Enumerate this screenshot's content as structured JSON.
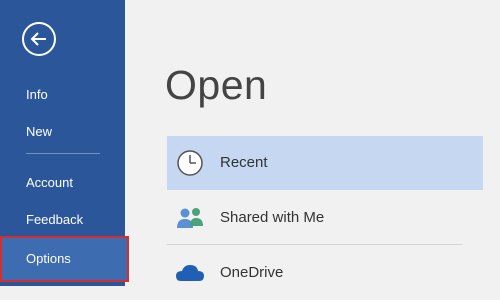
{
  "sidebar": {
    "back_icon": "back-arrow-icon",
    "items": [
      {
        "label": "Info"
      },
      {
        "label": "New"
      },
      {
        "label": "Account"
      },
      {
        "label": "Feedback"
      },
      {
        "label": "Options"
      }
    ],
    "highlight_color": "#d62d2d",
    "background": "#2b579a"
  },
  "main": {
    "title": "Open",
    "locations": [
      {
        "label": "Recent",
        "icon": "clock-icon"
      },
      {
        "label": "Shared with Me",
        "icon": "people-icon"
      },
      {
        "label": "OneDrive",
        "icon": "cloud-icon"
      }
    ]
  }
}
